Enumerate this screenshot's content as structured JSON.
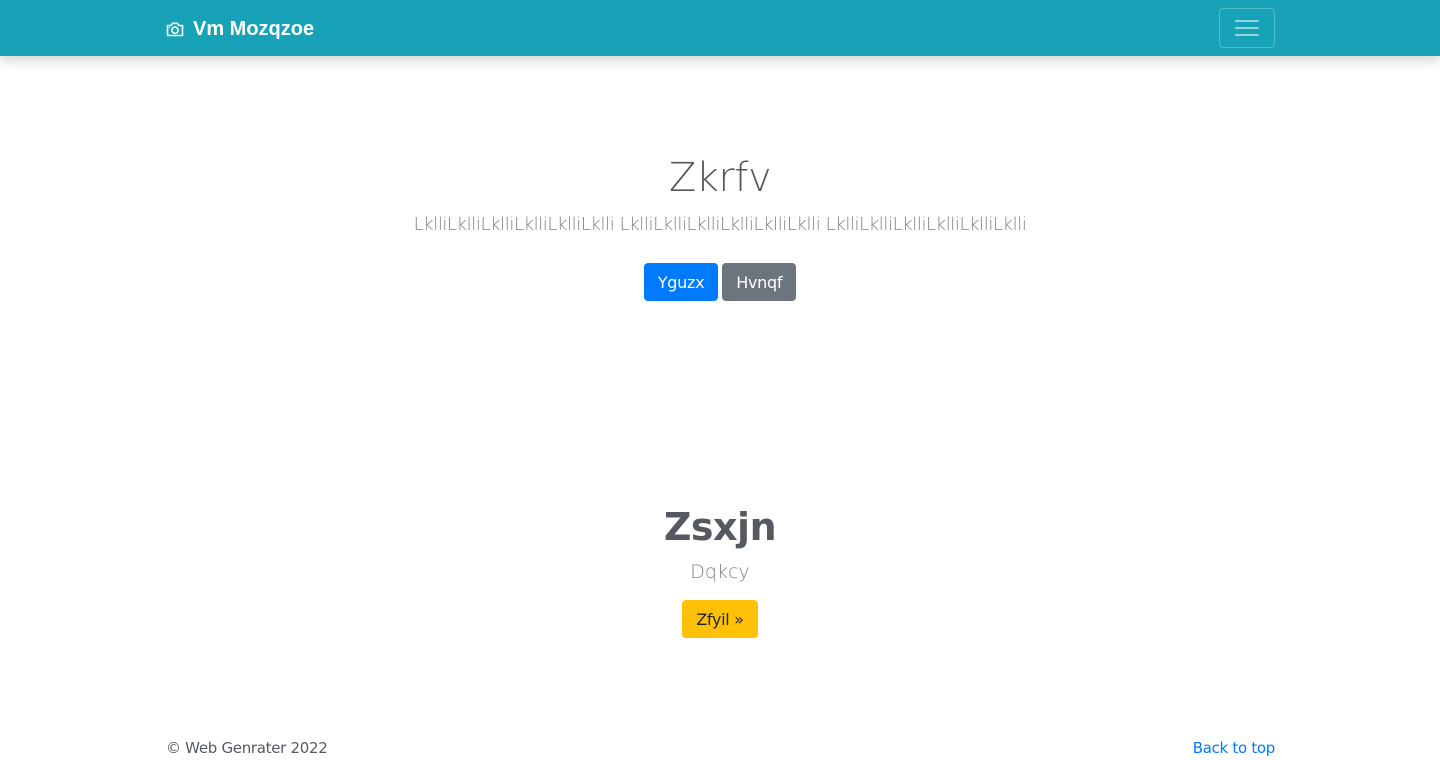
{
  "navbar": {
    "brand_icon": "camera-icon",
    "brand_text": "Vm Mozqzoe",
    "toggler_icon": "hamburger-menu-icon",
    "background": "#17a2b8"
  },
  "hero": {
    "title": "Zkrfv",
    "lead": "LklliLklliLklliLklliLklliLklli LklliLklliLklliLklliLklliLklli LklliLklliLklliLklliLklliLklli",
    "primary_button": "Yguzx",
    "secondary_button": "Hvnqf"
  },
  "feature": {
    "title": "Zsxjn",
    "subtitle": "Dqkcy",
    "button": "Zfyil »"
  },
  "footer": {
    "copyright": "© Web Genrater 2022",
    "back_to_top": "Back to top"
  },
  "colors": {
    "primary": "#007bff",
    "secondary": "#6c757d",
    "warning": "#ffc107",
    "info": "#17a2b8"
  }
}
